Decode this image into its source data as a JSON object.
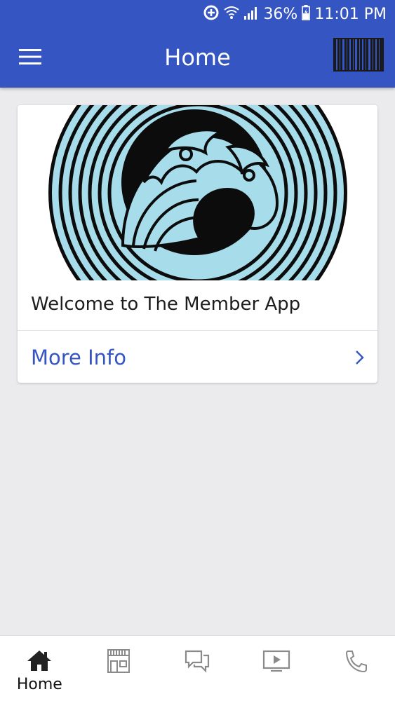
{
  "theme": {
    "accent": "#3556c2",
    "wave_light": "#a7dceb",
    "wave_dark": "#0c0c0c"
  },
  "status_bar": {
    "battery": "36%",
    "time": "11:01 PM",
    "icons": [
      "data-saver-icon",
      "wifi-icon",
      "signal-icon",
      "battery-icon"
    ]
  },
  "header": {
    "title": "Home",
    "menu_icon": "hamburger-menu-icon",
    "barcode_icon": "barcode-icon"
  },
  "card": {
    "image": "wave-logo",
    "title": "Welcome to The Member App",
    "action_label": "More Info",
    "action_icon": "chevron-right-icon"
  },
  "bottom_nav": {
    "items": [
      {
        "label": "Home",
        "icon": "home-icon",
        "active": true
      },
      {
        "label": "",
        "icon": "store-icon",
        "active": false
      },
      {
        "label": "",
        "icon": "chat-icon",
        "active": false
      },
      {
        "label": "",
        "icon": "video-icon",
        "active": false
      },
      {
        "label": "",
        "icon": "phone-icon",
        "active": false
      }
    ]
  }
}
